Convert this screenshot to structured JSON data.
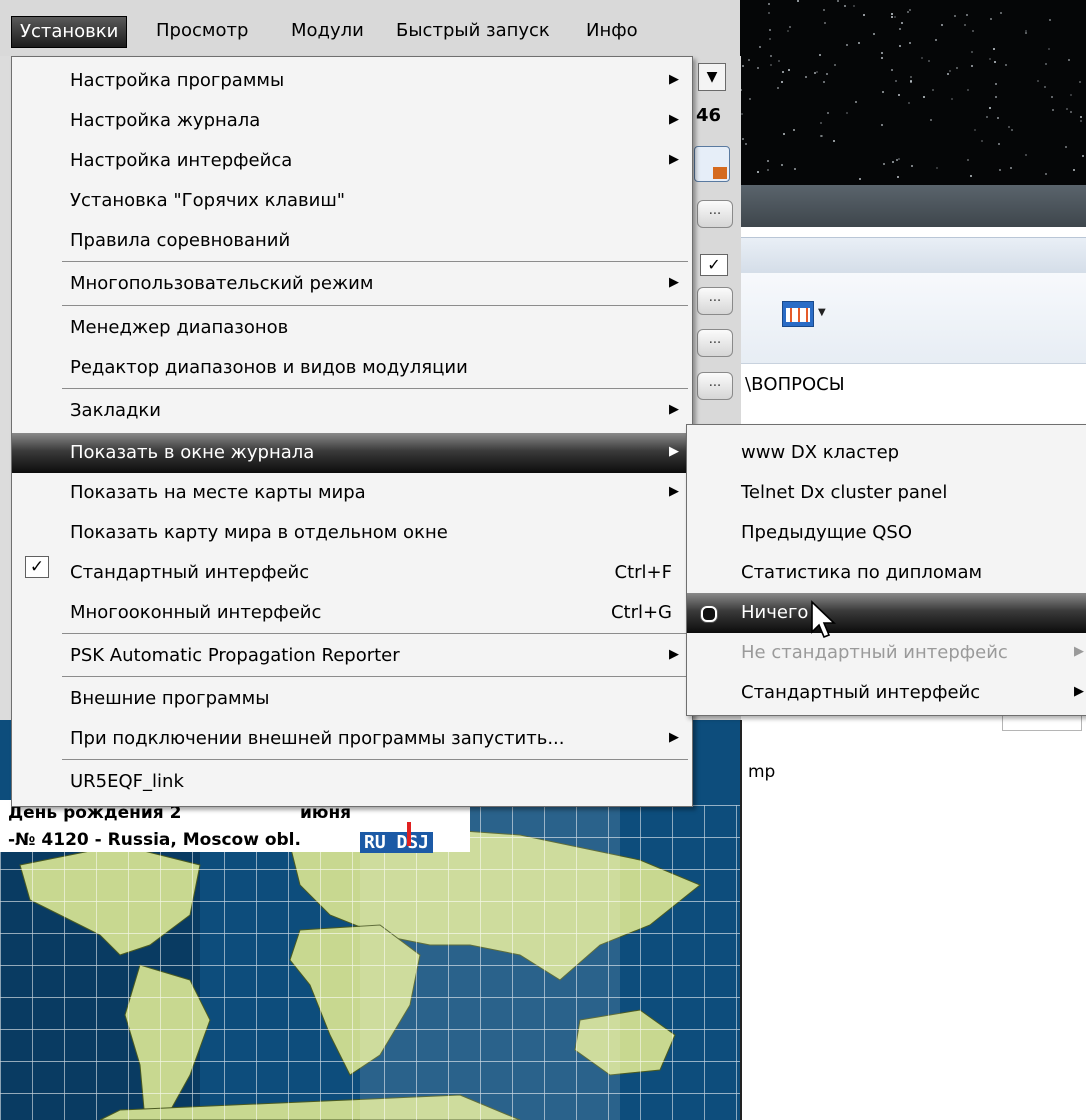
{
  "menubar": {
    "items": [
      "Установки",
      "Просмотр",
      "Модули",
      "Быстрый запуск",
      "Инфо"
    ],
    "active_index": 0
  },
  "main_menu": {
    "items": [
      {
        "label": "Настройка программы",
        "submenu": true
      },
      {
        "label": "Настройка журнала",
        "submenu": true
      },
      {
        "label": "Настройка интерфейса",
        "submenu": true
      },
      {
        "label": "Установка \"Горячих клавиш\""
      },
      {
        "label": "Правила соревнований"
      },
      {
        "label": "Многопользовательский режим",
        "submenu": true
      },
      {
        "label": "Менеджер диапазонов"
      },
      {
        "label": "Редактор диапазонов и видов модуляции"
      },
      {
        "label": "Закладки",
        "submenu": true
      },
      {
        "label": "Показать в окне журнала",
        "submenu": true,
        "highlighted": true
      },
      {
        "label": "Показать на месте карты мира",
        "submenu": true
      },
      {
        "label": "Показать карту мира в отдельном окне"
      },
      {
        "label": "Стандартный интерфейс",
        "shortcut": "Ctrl+F",
        "checked": true
      },
      {
        "label": "Многооконный интерфейс",
        "shortcut": "Ctrl+G"
      },
      {
        "label": "PSK Automatic Propagation Reporter",
        "submenu": true
      },
      {
        "label": "Внешние программы"
      },
      {
        "label": "При подключении внешней программы запустить...",
        "submenu": true
      },
      {
        "label": "UR5EQF_link"
      }
    ]
  },
  "submenu": {
    "items": [
      {
        "label": "www DX кластер"
      },
      {
        "label": "Telnet Dx cluster panel"
      },
      {
        "label": "Предыдущие QSO"
      },
      {
        "label": "Статистика по дипломам"
      },
      {
        "label": "Ничего",
        "selected": true,
        "highlighted": true
      },
      {
        "label": "Не стандартный интерфейс",
        "submenu": true,
        "disabled": true
      },
      {
        "label": "Стандартный интерфейс",
        "submenu": true
      }
    ]
  },
  "side": {
    "number": "46",
    "ellipsis": "..."
  },
  "background": {
    "questions_label": "\\ВОПРОСЫ",
    "mp_label": "mp"
  },
  "map": {
    "birthday_text": "День рождения 2",
    "birthday_month": "июня",
    "qth_text": "-№ 4120 - Russia, Moscow obl.",
    "callsign": "RU DSJ",
    "ocean_color": "#0d4d7c",
    "land_color": "#c8d890"
  },
  "colors": {
    "highlight_dark": "#0c0c0c",
    "menu_bg": "#f4f4f4"
  }
}
